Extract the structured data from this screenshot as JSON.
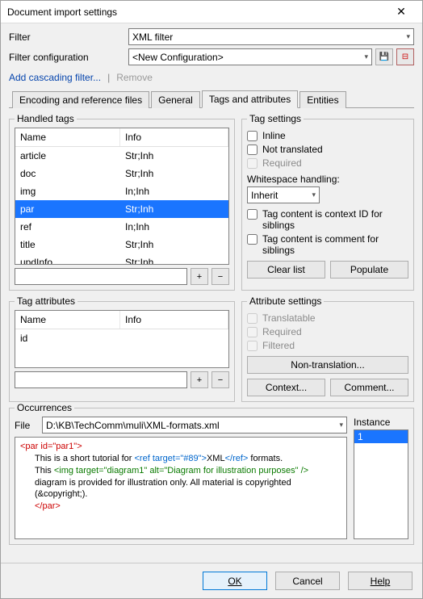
{
  "window": {
    "title": "Document import settings"
  },
  "filter": {
    "label": "Filter",
    "value": "XML filter"
  },
  "filterConfig": {
    "label": "Filter configuration",
    "value": "<New Configuration>"
  },
  "linkbar": {
    "addCascading": "Add cascading filter...",
    "remove": "Remove"
  },
  "tabs": {
    "encoding": "Encoding and reference files",
    "general": "General",
    "tagsAttrs": "Tags and attributes",
    "entities": "Entities"
  },
  "handledTags": {
    "legend": "Handled tags",
    "headers": {
      "name": "Name",
      "info": "Info"
    },
    "rows": [
      {
        "name": "article",
        "info": "Str;Inh"
      },
      {
        "name": "doc",
        "info": "Str;Inh"
      },
      {
        "name": "img",
        "info": "In;Inh"
      },
      {
        "name": "par",
        "info": "Str;Inh",
        "selected": true
      },
      {
        "name": "ref",
        "info": "In;Inh"
      },
      {
        "name": "title",
        "info": "Str;Inh"
      },
      {
        "name": "updInfo",
        "info": "Str;Inh"
      }
    ]
  },
  "tagSettings": {
    "legend": "Tag settings",
    "inline": "Inline",
    "notTranslated": "Not translated",
    "required": "Required",
    "whitespaceLabel": "Whitespace handling:",
    "whitespaceValue": "Inherit",
    "ctx1": "Tag content is context ID for siblings",
    "ctx2": "Tag content is comment for siblings",
    "clearList": "Clear list",
    "populate": "Populate"
  },
  "tagAttributes": {
    "legend": "Tag attributes",
    "headers": {
      "name": "Name",
      "info": "Info"
    },
    "rows": [
      {
        "name": "id",
        "info": ""
      }
    ]
  },
  "attributeSettings": {
    "legend": "Attribute settings",
    "translatable": "Translatable",
    "required": "Required",
    "filtered": "Filtered",
    "nonTranslation": "Non-translation...",
    "context": "Context...",
    "comment": "Comment..."
  },
  "occurrences": {
    "legend": "Occurrences",
    "fileLabel": "File",
    "fileValue": "D:\\KB\\TechComm\\muli\\XML-formats.xml",
    "instanceLabel": "Instance",
    "instances": [
      "1"
    ],
    "code": {
      "open": "<par id=\"par1\">",
      "line1a": "This is a short tutorial for ",
      "refOpen": "<ref target=\"#89\">",
      "refText": "XML",
      "refClose": "</ref>",
      "line1b": " formats.",
      "line2a": "This ",
      "img": "<img target=\"diagram1\" alt=\"Diagram for illustration purposes\" />",
      "line3": "diagram is provided for illustration only. All material is copyrighted",
      "line4": "(&copyright;).",
      "close": "</par>"
    }
  },
  "footer": {
    "ok": "OK",
    "cancel": "Cancel",
    "help": "Help"
  }
}
